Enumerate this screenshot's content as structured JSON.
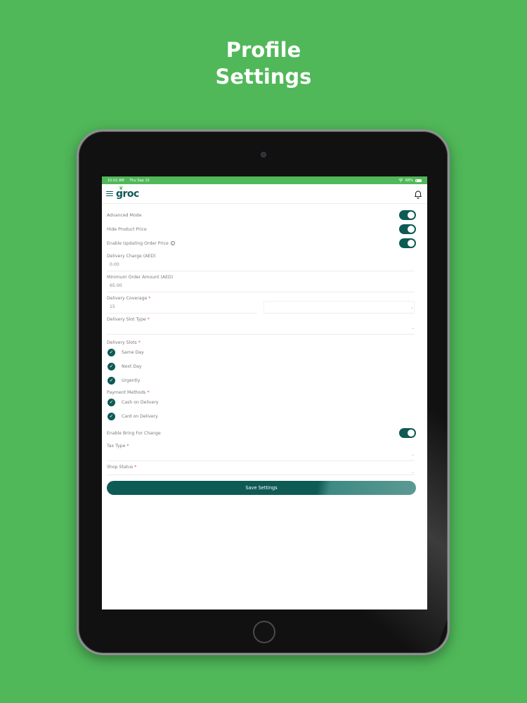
{
  "promo": {
    "line1": "Profile",
    "line2": "Settings"
  },
  "status_bar": {
    "time": "10:02 AM",
    "date": "Thu Sep 15",
    "battery": "68%"
  },
  "header": {
    "logo": "groc"
  },
  "toggles": [
    {
      "label": "Advanced Mode",
      "on": true
    },
    {
      "label": "Hide Product Price",
      "on": true
    },
    {
      "label": "Enable Updating Order Price",
      "on": true
    }
  ],
  "fields": {
    "delivery_charge": {
      "label": "Delivery Charge (AED)",
      "value": "0.00"
    },
    "min_order": {
      "label": "Minimum Order Amount (AED)",
      "value": "65.00"
    },
    "delivery_coverage": {
      "label": "Delivery Coverage",
      "value": "15"
    },
    "delivery_slot_type": {
      "label": "Delivery Slot Type"
    }
  },
  "delivery_slots": {
    "label": "Delivery Slots",
    "items": [
      "Same Day",
      "Next Day",
      "Urgently"
    ]
  },
  "payment_methods": {
    "label": "Payment Methods",
    "items": [
      "Cash on Delivery",
      "Card on Delivery"
    ]
  },
  "bring_change": {
    "label": "Enable Bring For Change",
    "on": true
  },
  "tax_type": {
    "label": "Tax Type"
  },
  "shop_status": {
    "label": "Shop Status"
  },
  "required_mark": "*",
  "save_button": "Save Settings",
  "colors": {
    "brand_green": "#50b859",
    "primary_teal": "#0e5a55"
  },
  "icons": {
    "menu": "hamburger-icon",
    "notifications": "bell-icon",
    "check": "check-icon",
    "info": "info-icon"
  }
}
